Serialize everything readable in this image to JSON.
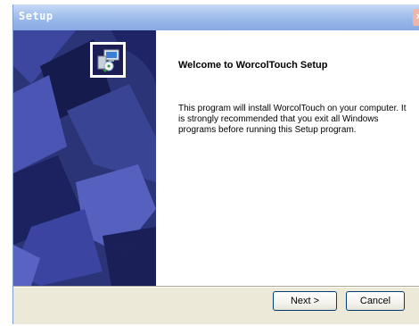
{
  "window": {
    "title": "Setup"
  },
  "icons": {
    "titlebar_close": "close-icon",
    "installer": "installer-icon"
  },
  "content": {
    "heading": "Welcome to WorcolTouch Setup",
    "body": "This program will install WorcolTouch on your computer.  It is strongly recommended that you exit all Windows programs before running this Setup program."
  },
  "buttons": {
    "next_label": "Next >",
    "cancel_label": "Cancel"
  },
  "colors": {
    "sidepanel_base": "#2b3477",
    "titlebar": "#93b3e8",
    "button_border": "#003c74"
  }
}
